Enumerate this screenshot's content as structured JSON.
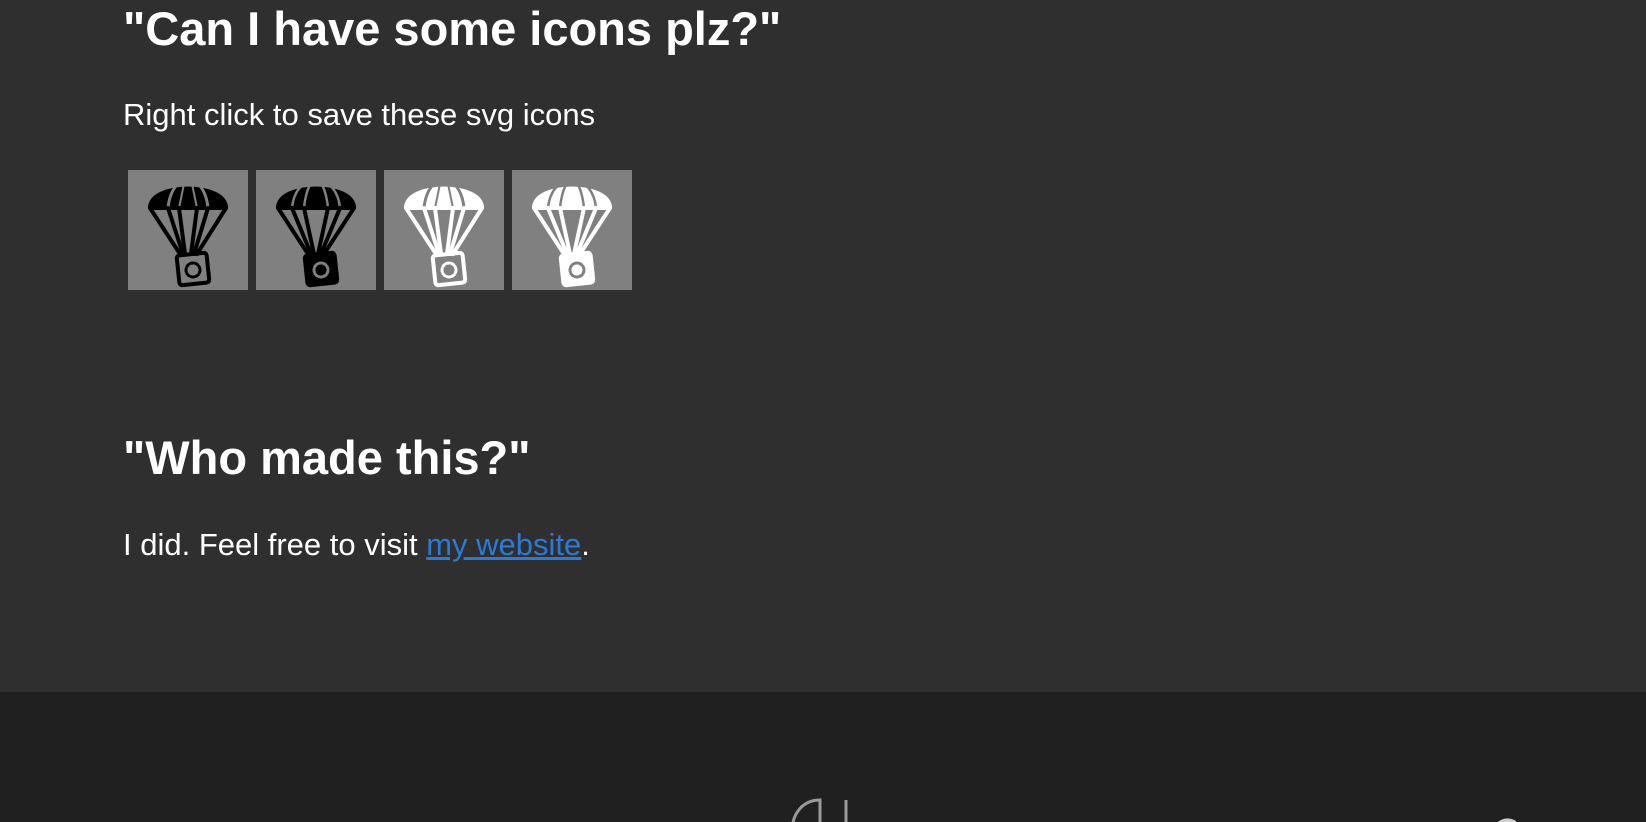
{
  "icons_section": {
    "heading": "\"Can I have some icons plz?\"",
    "subtext": "Right click to save these svg icons",
    "icons": [
      {
        "name": "parachute-icon-black-outline",
        "style": "black outline"
      },
      {
        "name": "parachute-icon-black-filled",
        "style": "black filled"
      },
      {
        "name": "parachute-icon-white-outline",
        "style": "white outline"
      },
      {
        "name": "parachute-icon-white-filled",
        "style": "white filled"
      }
    ],
    "tile_color": "#808080"
  },
  "about_section": {
    "heading": "\"Who made this?\"",
    "text_before": "I did. Feel free to visit ",
    "link_text": "my website",
    "text_after": "."
  },
  "colors": {
    "background": "#2f2f2f",
    "footer": "#202020",
    "link": "#2b7bd6",
    "text": "#ffffff"
  }
}
